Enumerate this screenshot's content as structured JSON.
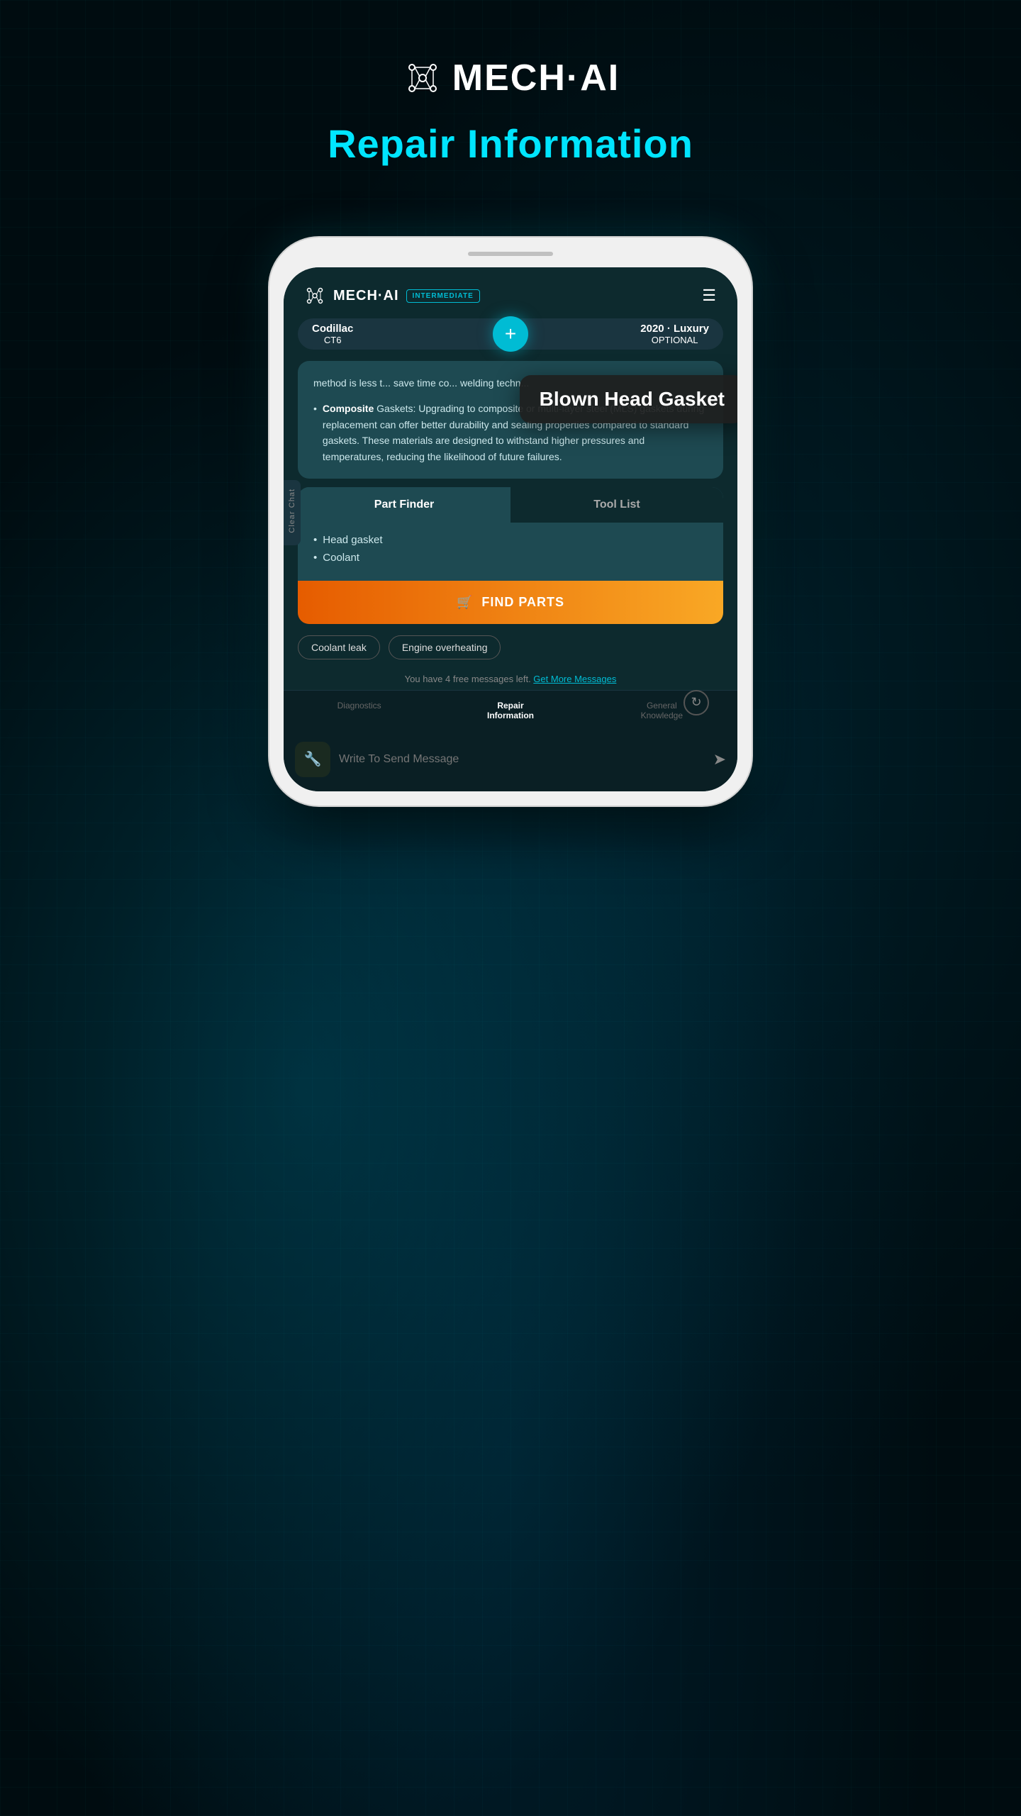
{
  "app": {
    "name": "MECH·AI",
    "page_title": "Repair Information",
    "logo_text": "MECH·AI"
  },
  "phone": {
    "header": {
      "logo": "MECH·AI",
      "badge": "INTERMEDIATE",
      "menu_icon": "≡"
    },
    "vehicle": {
      "name": "Codillac",
      "model": "CT6",
      "add_label": "+",
      "year": "2020 · Luxury",
      "trim": "OPTIONAL"
    },
    "clear_chat": "Clear Chat",
    "chat": {
      "partial_text": "method is less t... save time co... welding techn...",
      "bullet_text_bold": "Composite",
      "bullet_text_rest": " Gaskets: Upgrading to composite or multi-layer steel (MLS) gaskets during replacement can offer better durability and sealing properties compared to standard gaskets. These materials are designed to withstand higher pressures and temperatures, reducing the likelihood of future failures."
    },
    "tooltip": {
      "text": "Blown Head Gasket"
    },
    "part_finder": {
      "tab_active": "Part Finder",
      "tab_inactive": "Tool List",
      "parts": [
        "Head gasket",
        "Coolant"
      ],
      "find_parts_btn": "FIND PARTS",
      "cart_icon": "🛒"
    },
    "suggestions": [
      "Coolant leak",
      "Engine overheating"
    ],
    "free_messages": {
      "text": "You have 4 free messages left.",
      "link_text": "Get More Messages"
    },
    "bottom_nav": [
      {
        "label": "Diagnostics",
        "active": false
      },
      {
        "label": "Repair\nInformation",
        "active": true
      },
      {
        "label": "General\nKnowledge",
        "active": false
      }
    ],
    "message_input": {
      "placeholder": "Write To Send Message",
      "send_icon": "➤"
    }
  }
}
